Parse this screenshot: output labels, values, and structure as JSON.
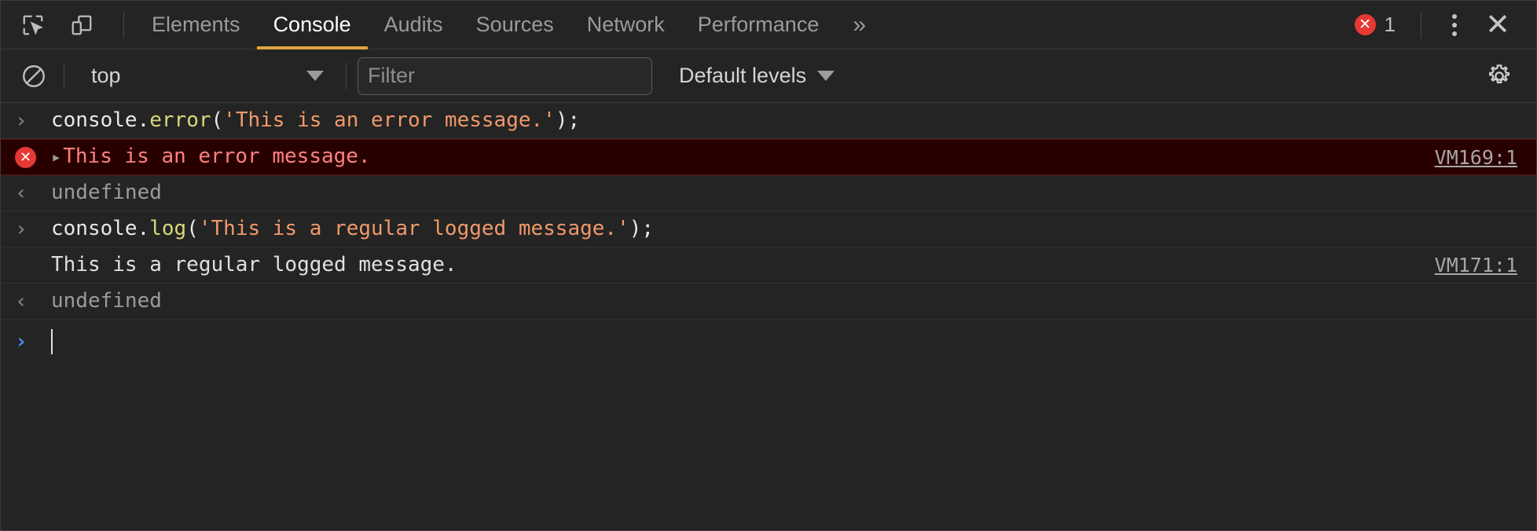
{
  "toolbar": {
    "inspect_icon": "inspect-element-icon",
    "device_icon": "device-toolbar-icon",
    "more_tabs_label": "»",
    "error_count": "1",
    "error_badge_glyph": "✕",
    "close_glyph": "✕"
  },
  "tabs": [
    {
      "label": "Elements",
      "active": false
    },
    {
      "label": "Console",
      "active": true
    },
    {
      "label": "Audits",
      "active": false
    },
    {
      "label": "Sources",
      "active": false
    },
    {
      "label": "Network",
      "active": false
    },
    {
      "label": "Performance",
      "active": false
    }
  ],
  "filterbar": {
    "clear_icon": "clear-console-icon",
    "context_value": "top",
    "filter_placeholder": "Filter",
    "filter_value": "",
    "levels_label": "Default levels",
    "gear_icon": "settings-gear-icon"
  },
  "console_rows": [
    {
      "kind": "input",
      "gutter": "›",
      "tokens": [
        {
          "t": "console",
          "c": "tok-plain"
        },
        {
          "t": ".",
          "c": "tok-punct"
        },
        {
          "t": "error",
          "c": "tok-method"
        },
        {
          "t": "(",
          "c": "tok-punct"
        },
        {
          "t": "'This is an error message.'",
          "c": "tok-string"
        },
        {
          "t": ");",
          "c": "tok-punct"
        }
      ],
      "link": ""
    },
    {
      "kind": "error",
      "gutter": "error-icon",
      "expander": "▸",
      "text": "This is an error message.",
      "link": "VM169:1"
    },
    {
      "kind": "result",
      "gutter": "‹",
      "text": "undefined",
      "link": ""
    },
    {
      "kind": "input",
      "gutter": "›",
      "tokens": [
        {
          "t": "console",
          "c": "tok-plain"
        },
        {
          "t": ".",
          "c": "tok-punct"
        },
        {
          "t": "log",
          "c": "tok-method"
        },
        {
          "t": "(",
          "c": "tok-punct"
        },
        {
          "t": "'This is a regular logged message.'",
          "c": "tok-string"
        },
        {
          "t": ");",
          "c": "tok-punct"
        }
      ],
      "link": ""
    },
    {
      "kind": "log",
      "gutter": "",
      "text": "This is a regular logged message.",
      "link": "VM171:1"
    },
    {
      "kind": "result",
      "gutter": "‹",
      "text": "undefined",
      "link": ""
    },
    {
      "kind": "prompt",
      "gutter": "›",
      "text": "",
      "link": ""
    }
  ],
  "colors": {
    "background": "#242424",
    "active_tab_underline": "#e0a33e",
    "error_red": "#e53935",
    "error_row_bg": "#290000",
    "error_text": "#ff8080",
    "string_token": "#f0996a",
    "method_token": "#d7d77a",
    "prompt_blue": "#4a8df8"
  }
}
